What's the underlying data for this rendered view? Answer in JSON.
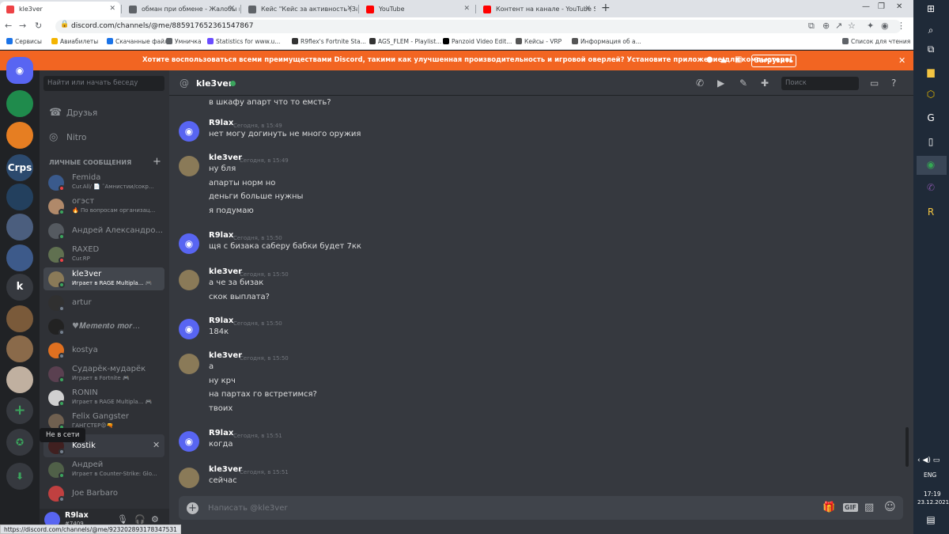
{
  "browser": {
    "tabs": [
      {
        "title": "kle3ver",
        "active": true
      },
      {
        "title": "обман при обмене - Жалобы на"
      },
      {
        "title": "Кейс \"Кейс за активность (За 4"
      },
      {
        "title": "YouTube"
      },
      {
        "title": "Контент на канале - YouTube St"
      }
    ],
    "url": "discord.com/channels/@me/885917652361547867",
    "bookmarks": [
      "Сервисы",
      "Авиабилеты",
      "Скачанные файлы",
      "Умничка",
      "Statistics for www.u...",
      "R9flex's Fortnite Sta...",
      "AGS_FLEM - Playlist...",
      "Panzoid Video Edit...",
      "Кейсы - VRP",
      "Информация об а..."
    ],
    "reading_list": "Список для чтения",
    "status_url": "https://discord.com/channels/@me/923202893178347531"
  },
  "notice": {
    "text": "Хотите воспользоваться всеми преимуществами Discord, такими как улучшенная производительность и игровой оверлей? Установите приложение для компьютера!",
    "button": "Загрузить"
  },
  "servers": [
    {
      "label": ""
    },
    {
      "label": ""
    },
    {
      "label": "Crps"
    },
    {
      "label": ""
    },
    {
      "label": ""
    },
    {
      "label": ""
    },
    {
      "label": "k"
    },
    {
      "label": ""
    },
    {
      "label": ""
    },
    {
      "label": ""
    }
  ],
  "dm": {
    "search_placeholder": "Найти или начать беседу",
    "nav": [
      {
        "label": "Друзья"
      },
      {
        "label": "Nitro"
      }
    ],
    "section_title": "ЛИЧНЫЕ СООБЩЕНИЯ",
    "items": [
      {
        "name": "Femida",
        "sub": "Cur.All/ 📄 ˜Амнистии/сокр...",
        "color": "#3a5a8c",
        "status": "#ed4245"
      },
      {
        "name": "огэст",
        "sub": "🔥 По вопросам организац...",
        "color": "#b0896a",
        "status": "#3ba55d"
      },
      {
        "name": "Андрей Александро...",
        "sub": "",
        "color": "#555a60",
        "status": "#3ba55d"
      },
      {
        "name": "RAXED",
        "sub": "Cur.RP",
        "color": "#607050",
        "status": "#ed4245"
      },
      {
        "name": "kle3ver",
        "sub": "Играет в RAGE Multipla... 🎮",
        "color": "#8a7a58",
        "status": "#3ba55d"
      },
      {
        "name": "artur",
        "sub": "",
        "color": "#303030",
        "status": "#747f8d"
      },
      {
        "name": "♥𝑴𝒆𝒎𝒆𝒏𝒕𝒐 𝒎𝒐𝒓...",
        "sub": "",
        "color": "#222222",
        "status": "#747f8d"
      },
      {
        "name": "kostya",
        "sub": "",
        "color": "#e07020",
        "status": "#747f8d"
      },
      {
        "name": "Сударёк-мударёк",
        "sub": "Играет в Fortnite 🎮",
        "color": "#5a4050",
        "status": "#3ba55d"
      },
      {
        "name": "RONIN",
        "sub": "Играет в RAGE Multipla... 🎮",
        "color": "#d0d0d0",
        "status": "#3ba55d"
      },
      {
        "name": "Felix Gangster",
        "sub": "ГАНГСТЕР😡🔫",
        "color": "#706050",
        "status": "#3ba55d"
      },
      {
        "name": "Kostik",
        "sub": "",
        "color": "#402020",
        "status": "#747f8d"
      },
      {
        "name": "Андрей",
        "sub": "Играет в Counter-Strike: Glo...",
        "color": "#506048",
        "status": "#3ba55d"
      },
      {
        "name": "Joe Barbaro",
        "sub": "",
        "color": "#c04040",
        "status": "#747f8d"
      }
    ],
    "tooltip": "Не в сети"
  },
  "user": {
    "name": "R9lax",
    "tag": "#7409"
  },
  "chat": {
    "recipient": "kle3ver",
    "search_placeholder": "Поиск",
    "input_placeholder": "Написать @kle3ver",
    "first_line": "в шкафу апарт что то емсть?",
    "messages": [
      {
        "author": "R9lax",
        "time": "Сегодня, в 15:49",
        "lines": [
          "нет могу догинуть не много оружия"
        ],
        "discord": true
      },
      {
        "author": "kle3ver",
        "time": "Сегодня, в 15:49",
        "lines": [
          "ну бля",
          "апарты норм но",
          "деньги больше нужны",
          "я подумаю"
        ],
        "discord": false
      },
      {
        "author": "R9lax",
        "time": "Сегодня, в 15:50",
        "lines": [
          "щя с бизака саберу бабки будет 7кк"
        ],
        "discord": true
      },
      {
        "author": "kle3ver",
        "time": "Сегодня, в 15:50",
        "lines": [
          "а че за бизак",
          "скок выплата?"
        ],
        "discord": false
      },
      {
        "author": "R9lax",
        "time": "Сегодня, в 15:50",
        "lines": [
          "184к"
        ],
        "discord": true
      },
      {
        "author": "kle3ver",
        "time": "Сегодня, в 15:50",
        "lines": [
          "а",
          "ну крч",
          "на партах го встретимся?",
          "твоих"
        ],
        "discord": false
      },
      {
        "author": "R9lax",
        "time": "Сегодня, в 15:51",
        "lines": [
          "когда"
        ],
        "discord": true
      },
      {
        "author": "kle3ver",
        "time": "Сегодня, в 15:51",
        "lines": [
          "сейчас"
        ],
        "discord": false
      }
    ]
  },
  "taskbar": {
    "lang": "ENG",
    "time": "17:19",
    "date": "23.12.2021"
  }
}
